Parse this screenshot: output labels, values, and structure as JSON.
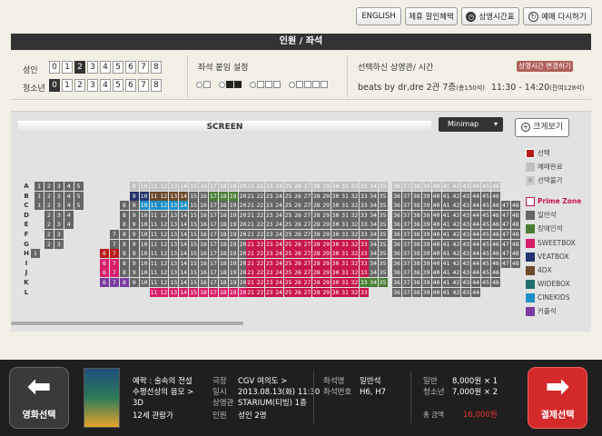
{
  "top_buttons": {
    "english": "ENGLISH",
    "discount": "제휴 할인혜택",
    "schedule": "상영시간표",
    "restart": "예매 다시하기"
  },
  "title": "인원 / 좌석",
  "people": {
    "adult_label": "성인",
    "youth_label": "청소년",
    "numbers": [
      "0",
      "1",
      "2",
      "3",
      "4",
      "5",
      "6",
      "7",
      "8"
    ],
    "adult_selected": "2",
    "youth_selected": "0"
  },
  "seat_setting": {
    "label": "좌석 붙임 설정"
  },
  "selection": {
    "label": "선택하신 상영관/ 시간",
    "change_button": "상영시간 변경하기",
    "movie": "beats by dr,dre 2관 7층",
    "total_seats": "(총150석)",
    "time": "11:30 - 14:20",
    "remaining": "(잔여128석)"
  },
  "screen_label": "SCREEN",
  "minimap_label": "Minimap",
  "zoom_label": "크게보기",
  "rows": [
    "A",
    "B",
    "C",
    "D",
    "E",
    "F",
    "G",
    "H",
    "I",
    "J",
    "K",
    "L"
  ],
  "legend": {
    "selected": "선택",
    "reserved": "예매완료",
    "unavailable": "선택불가",
    "prime_zone": "Prime Zone",
    "general": "일반석",
    "disabled": "장애인석",
    "sweetbox": "SWEETBOX",
    "veatbox": "VEATBOX",
    "fourdx": "4DX",
    "widebox": "WIDEBOX",
    "cinekids": "CINEKIDS",
    "couple": "커플석"
  },
  "colors": {
    "general": "#666666",
    "prime": "#c8174a",
    "sweetbox": "#d81e6b",
    "veatbox": "#23336e",
    "fourdx": "#6b4a2b",
    "widebox": "#4a7e36",
    "cinekids": "#1e90c8",
    "couple": "#7a3ca0",
    "reserved": "#c0c0c0",
    "selected": "#b81a1a",
    "accent": "#e22320"
  },
  "bottom": {
    "prev_label": "영화선택",
    "next_label": "결제선택",
    "movie_title": "예락 : 술속의 전설",
    "movie_sub": "수평선상의 음모 >",
    "format": "3D",
    "rating": "12세 관람가",
    "theater_label": "극장",
    "theater": "CGV 여의도 >",
    "date_label": "일시",
    "date": "2013.08.13(화) 11:30",
    "hall_label": "상영관",
    "hall": "STARIUM(티빙) 1층",
    "people_label": "인원",
    "people": "성인 2명",
    "seat_name_label": "좌석명",
    "seat_name": "일반석",
    "seat_no_label": "좌석번호",
    "seat_no": "H6, H7",
    "adult_label": "일반",
    "adult_price": "8,000원 × 1",
    "youth_label": "청소년",
    "youth_price": "7,000원 × 2",
    "total_label": "총 금액",
    "total": "16,000원"
  }
}
